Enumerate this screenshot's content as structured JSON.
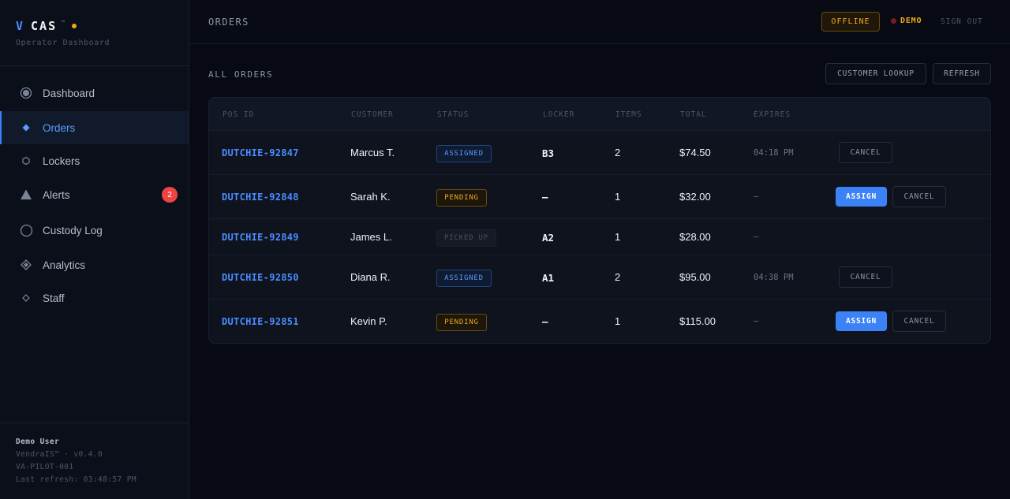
{
  "brand": {
    "v": "V",
    "name": "CAS",
    "tm": "™",
    "subtitle": "Operator Dashboard"
  },
  "nav": [
    {
      "label": "Dashboard",
      "icon": "radio-dot-icon"
    },
    {
      "label": "Orders",
      "icon": "diamond-icon",
      "active": true
    },
    {
      "label": "Lockers",
      "icon": "hexagon-icon"
    },
    {
      "label": "Alerts",
      "icon": "triangle-icon",
      "badge": "2"
    },
    {
      "label": "Custody Log",
      "icon": "circle-icon"
    },
    {
      "label": "Analytics",
      "icon": "diamond-outline-icon"
    },
    {
      "label": "Staff",
      "icon": "small-diamond-icon"
    }
  ],
  "footer": {
    "user": "Demo User",
    "version": "VendraIS™ · v0.4.0",
    "site": "VA-PILOT-001",
    "refresh": "Last refresh: 03:48:57 PM"
  },
  "topbar": {
    "title": "ORDERS",
    "offline": "OFFLINE",
    "demo": "DEMO",
    "signout": "SIGN OUT"
  },
  "main": {
    "section_title": "ALL ORDERS",
    "lookup": "CUSTOMER LOOKUP",
    "refresh": "REFRESH"
  },
  "colors": {
    "accent": "#3b82f6",
    "warning": "#f0a81c",
    "danger": "#ef4444"
  },
  "table": {
    "headers": [
      "POS ID",
      "CUSTOMER",
      "STATUS",
      "LOCKER",
      "ITEMS",
      "TOTAL",
      "EXPIRES"
    ],
    "rows": [
      {
        "pos": "DUTCHIE-92847",
        "customer": "Marcus T.",
        "status": "ASSIGNED",
        "locker": "B3",
        "items": "2",
        "total": "$74.50",
        "expires": "04:18 PM",
        "assign": "",
        "cancel": "CANCEL"
      },
      {
        "pos": "DUTCHIE-92848",
        "customer": "Sarah K.",
        "status": "PENDING",
        "locker": "—",
        "items": "1",
        "total": "$32.00",
        "expires": "—",
        "assign": "ASSIGN",
        "cancel": "CANCEL"
      },
      {
        "pos": "DUTCHIE-92849",
        "customer": "James L.",
        "status": "PICKED UP",
        "locker": "A2",
        "items": "1",
        "total": "$28.00",
        "expires": "—",
        "assign": "",
        "cancel": ""
      },
      {
        "pos": "DUTCHIE-92850",
        "customer": "Diana R.",
        "status": "ASSIGNED",
        "locker": "A1",
        "items": "2",
        "total": "$95.00",
        "expires": "04:38 PM",
        "assign": "",
        "cancel": "CANCEL"
      },
      {
        "pos": "DUTCHIE-92851",
        "customer": "Kevin P.",
        "status": "PENDING",
        "locker": "—",
        "items": "1",
        "total": "$115.00",
        "expires": "—",
        "assign": "ASSIGN",
        "cancel": "CANCEL"
      }
    ]
  }
}
